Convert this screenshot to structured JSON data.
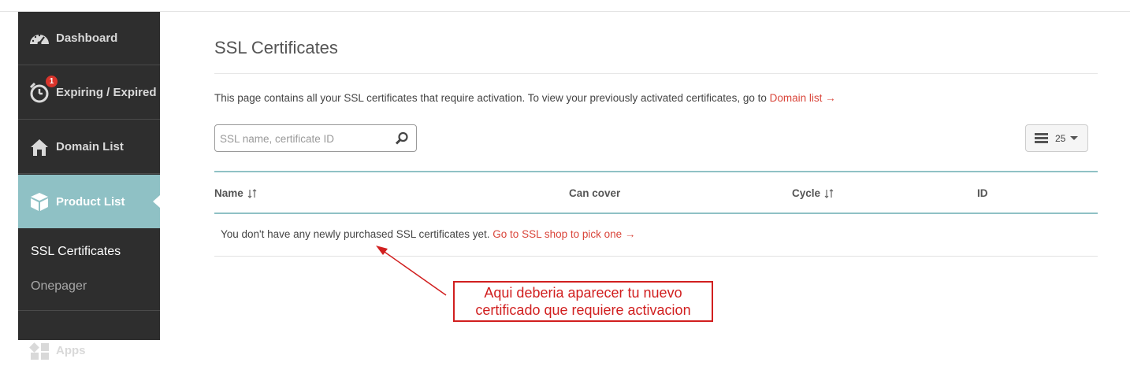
{
  "sidebar": {
    "items": [
      {
        "label": "Dashboard",
        "icon": "speedometer-icon"
      },
      {
        "label": "Expiring / Expired",
        "icon": "alarm-clock-icon",
        "badge": "1"
      },
      {
        "label": "Domain List",
        "icon": "home-icon"
      },
      {
        "label": "Product List",
        "icon": "box-icon",
        "active": true
      },
      {
        "label": "Apps",
        "icon": "apps-icon"
      }
    ],
    "subitems": [
      {
        "label": "SSL Certificates",
        "active": true
      },
      {
        "label": "Onepager",
        "active": false
      }
    ]
  },
  "main": {
    "title": "SSL Certificates",
    "intro_text": "This page contains all your SSL certificates that require activation. To view your previously activated certificates, go to ",
    "intro_link": "Domain list →",
    "search": {
      "placeholder": "SSL name, certificate ID",
      "value": ""
    },
    "per_page": {
      "value": "25"
    },
    "table": {
      "columns": [
        "Name",
        "Can cover",
        "Cycle",
        "ID"
      ],
      "empty_text": "You don't have any newly purchased SSL certificates yet. ",
      "empty_link": "Go to SSL shop to pick one →"
    }
  },
  "annotation": {
    "line1": "Aqui deberia aparecer tu nuevo",
    "line2": "certificado que requiere activacion"
  },
  "colors": {
    "sidebar_bg": "#2e2e2e",
    "active_bg": "#8fc1c5",
    "link": "#d9453a",
    "badge": "#d9342b",
    "annotation": "#d11f1f"
  }
}
